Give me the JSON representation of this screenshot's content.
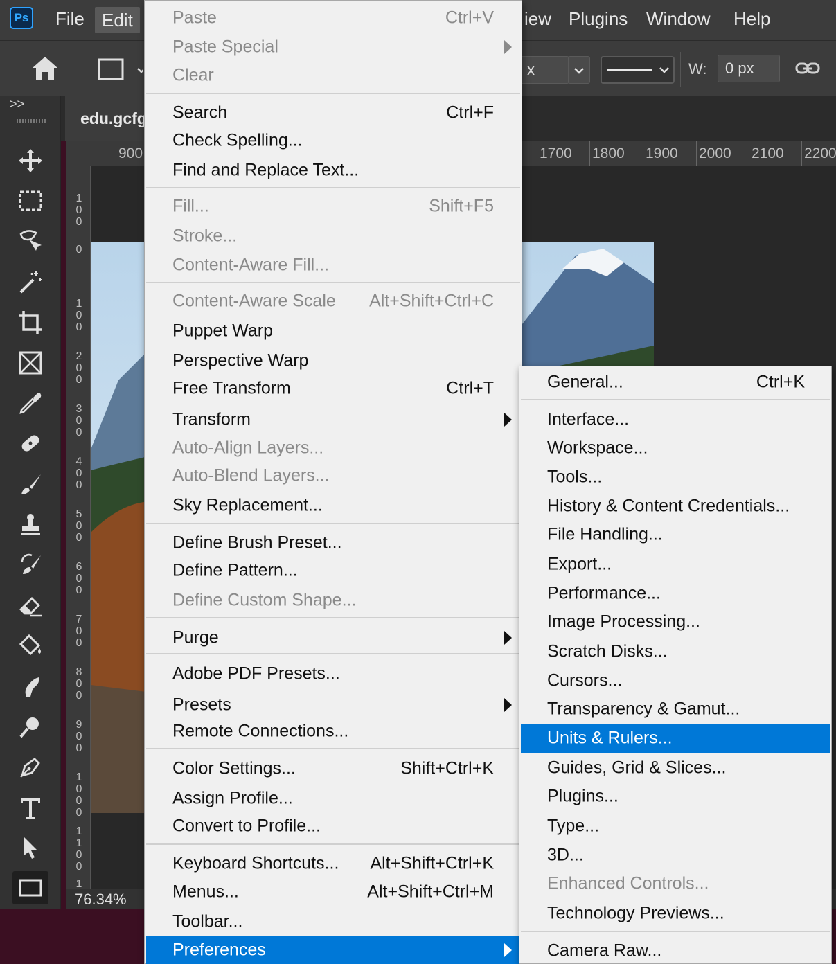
{
  "app": {
    "logo": "Ps",
    "menubar": [
      "File",
      "Edit",
      "View",
      "Plugins",
      "Window",
      "Help"
    ],
    "menubar_visible_view": "iew"
  },
  "options": {
    "stroke_unit_partial": "x",
    "width_label": "W:",
    "width_value": "0 px"
  },
  "document": {
    "tab_title": "edu.gcfg",
    "panel_toggle": ">>",
    "zoom": "76.34%",
    "ruler_top": [
      "900",
      "1700",
      "1800",
      "1900",
      "2000",
      "2100",
      "2200"
    ],
    "ruler_left": [
      [
        "1",
        "0",
        "0"
      ],
      [
        "0"
      ],
      [
        "1",
        "0",
        "0"
      ],
      [
        "2",
        "0",
        "0"
      ],
      [
        "3",
        "0",
        "0"
      ],
      [
        "4",
        "0",
        "0"
      ],
      [
        "5",
        "0",
        "0"
      ],
      [
        "6",
        "0",
        "0"
      ],
      [
        "7",
        "0",
        "0"
      ],
      [
        "8",
        "0",
        "0"
      ],
      [
        "9",
        "0",
        "0"
      ],
      [
        "1",
        "0",
        "0",
        "0"
      ],
      [
        "1",
        "1",
        "0",
        "0"
      ],
      [
        "1"
      ]
    ]
  },
  "toolbar": [
    "move-tool",
    "rectangular-marquee-tool",
    "object-selection-tool",
    "magic-wand-tool",
    "crop-tool",
    "frame-tool",
    "eyedropper-tool",
    "spot-healing-tool",
    "brush-tool",
    "clone-stamp-tool",
    "history-brush-tool",
    "eraser-tool",
    "paint-bucket-tool",
    "smudge-tool",
    "dodge-tool",
    "pen-tool",
    "type-tool",
    "path-selection-tool",
    "rectangle-tool"
  ],
  "edit_menu": {
    "items": [
      {
        "label": "Paste",
        "shortcut": "Ctrl+V",
        "disabled": true
      },
      {
        "label": "Paste Special",
        "shortcut": "",
        "disabled": true,
        "submenu": true
      },
      {
        "label": "Clear",
        "shortcut": "",
        "disabled": true
      },
      {
        "label": "Search",
        "shortcut": "Ctrl+F",
        "disabled": false
      },
      {
        "label": "Check Spelling...",
        "shortcut": "",
        "disabled": false
      },
      {
        "label": "Find and Replace Text...",
        "shortcut": "",
        "disabled": false
      },
      {
        "label": "Fill...",
        "shortcut": "Shift+F5",
        "disabled": true
      },
      {
        "label": "Stroke...",
        "shortcut": "",
        "disabled": true
      },
      {
        "label": "Content-Aware Fill...",
        "shortcut": "",
        "disabled": true
      },
      {
        "label": "Content-Aware Scale",
        "shortcut": "Alt+Shift+Ctrl+C",
        "disabled": true
      },
      {
        "label": "Puppet Warp",
        "shortcut": "",
        "disabled": false
      },
      {
        "label": "Perspective Warp",
        "shortcut": "",
        "disabled": false
      },
      {
        "label": "Free Transform",
        "shortcut": "Ctrl+T",
        "disabled": false
      },
      {
        "label": "Transform",
        "shortcut": "",
        "disabled": false,
        "submenu": true
      },
      {
        "label": "Auto-Align Layers...",
        "shortcut": "",
        "disabled": true
      },
      {
        "label": "Auto-Blend Layers...",
        "shortcut": "",
        "disabled": true
      },
      {
        "label": "Sky Replacement...",
        "shortcut": "",
        "disabled": false
      },
      {
        "label": "Define Brush Preset...",
        "shortcut": "",
        "disabled": false
      },
      {
        "label": "Define Pattern...",
        "shortcut": "",
        "disabled": false
      },
      {
        "label": "Define Custom Shape...",
        "shortcut": "",
        "disabled": true
      },
      {
        "label": "Purge",
        "shortcut": "",
        "disabled": false,
        "submenu": true
      },
      {
        "label": "Adobe PDF Presets...",
        "shortcut": "",
        "disabled": false
      },
      {
        "label": "Presets",
        "shortcut": "",
        "disabled": false,
        "submenu": true
      },
      {
        "label": "Remote Connections...",
        "shortcut": "",
        "disabled": false
      },
      {
        "label": "Color Settings...",
        "shortcut": "Shift+Ctrl+K",
        "disabled": false
      },
      {
        "label": "Assign Profile...",
        "shortcut": "",
        "disabled": false
      },
      {
        "label": "Convert to Profile...",
        "shortcut": "",
        "disabled": false
      },
      {
        "label": "Keyboard Shortcuts...",
        "shortcut": "Alt+Shift+Ctrl+K",
        "disabled": false
      },
      {
        "label": "Menus...",
        "shortcut": "Alt+Shift+Ctrl+M",
        "disabled": false
      },
      {
        "label": "Toolbar...",
        "shortcut": "",
        "disabled": false
      },
      {
        "label": "Preferences",
        "shortcut": "",
        "disabled": false,
        "submenu": true,
        "highlighted": true
      }
    ]
  },
  "preferences_menu": {
    "items": [
      {
        "label": "General...",
        "shortcut": "Ctrl+K",
        "disabled": false
      },
      {
        "label": "Interface...",
        "shortcut": "",
        "disabled": false
      },
      {
        "label": "Workspace...",
        "shortcut": "",
        "disabled": false
      },
      {
        "label": "Tools...",
        "shortcut": "",
        "disabled": false
      },
      {
        "label": "History & Content Credentials...",
        "shortcut": "",
        "disabled": false
      },
      {
        "label": "File Handling...",
        "shortcut": "",
        "disabled": false
      },
      {
        "label": "Export...",
        "shortcut": "",
        "disabled": false
      },
      {
        "label": "Performance...",
        "shortcut": "",
        "disabled": false
      },
      {
        "label": "Image Processing...",
        "shortcut": "",
        "disabled": false
      },
      {
        "label": "Scratch Disks...",
        "shortcut": "",
        "disabled": false
      },
      {
        "label": "Cursors...",
        "shortcut": "",
        "disabled": false
      },
      {
        "label": "Transparency & Gamut...",
        "shortcut": "",
        "disabled": false
      },
      {
        "label": "Units & Rulers...",
        "shortcut": "",
        "disabled": false,
        "highlighted": true
      },
      {
        "label": "Guides, Grid & Slices...",
        "shortcut": "",
        "disabled": false
      },
      {
        "label": "Plugins...",
        "shortcut": "",
        "disabled": false
      },
      {
        "label": "Type...",
        "shortcut": "",
        "disabled": false
      },
      {
        "label": "3D...",
        "shortcut": "",
        "disabled": false
      },
      {
        "label": "Enhanced Controls...",
        "shortcut": "",
        "disabled": true
      },
      {
        "label": "Technology Previews...",
        "shortcut": "",
        "disabled": false
      },
      {
        "label": "Camera Raw...",
        "shortcut": "",
        "disabled": false
      }
    ]
  },
  "colors": {
    "highlight": "#0078d7",
    "menu_bg": "#f0f0f0",
    "app_bg": "#3c3c3c",
    "disabled_text": "#8a8a8a"
  }
}
